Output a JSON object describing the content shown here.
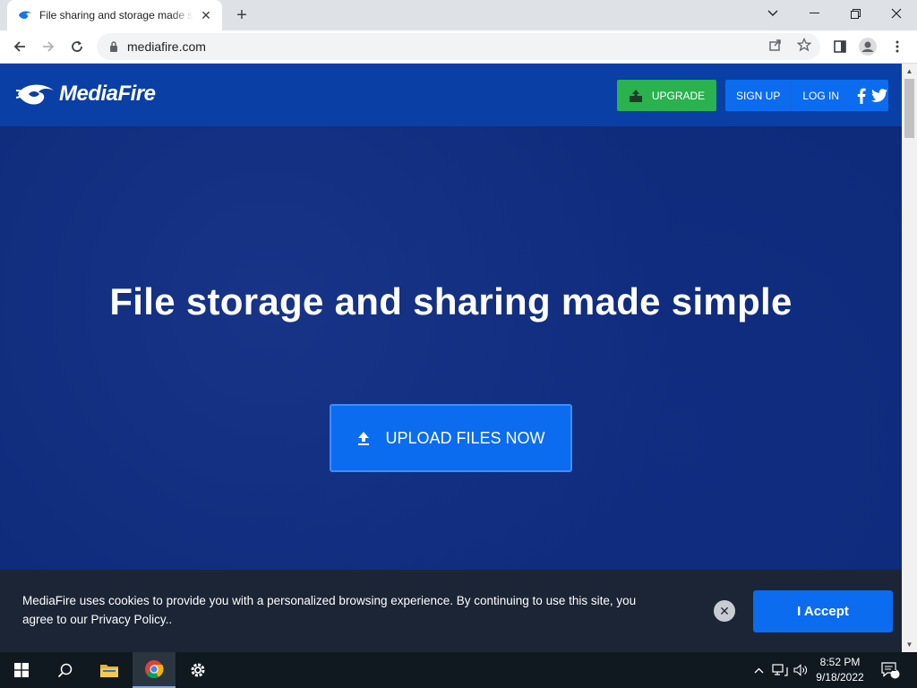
{
  "browser": {
    "tab_title": "File sharing and storage made simple",
    "url": "mediafire.com"
  },
  "header": {
    "logo_text": "MediaFire",
    "upgrade_label": "UPGRADE",
    "signup_label": "SIGN UP",
    "login_label": "LOG IN"
  },
  "hero": {
    "title": "File storage and sharing made simple",
    "upload_label": "UPLOAD FILES NOW"
  },
  "cookie": {
    "line1": "MediaFire uses cookies to provide you with a personalized browsing experience. By continuing to use this site, you",
    "line2": "agree to our Privacy Policy..",
    "accept_label": "I Accept",
    "close_label": "✕"
  },
  "taskbar": {
    "time": "8:52 PM",
    "date": "9/18/2022",
    "notification_count": "1"
  },
  "colors": {
    "brand_blue": "#0b6cf0",
    "header_blue": "#0a3fa6",
    "upgrade_green": "#29b24e",
    "cookie_bg": "#1b2535"
  }
}
